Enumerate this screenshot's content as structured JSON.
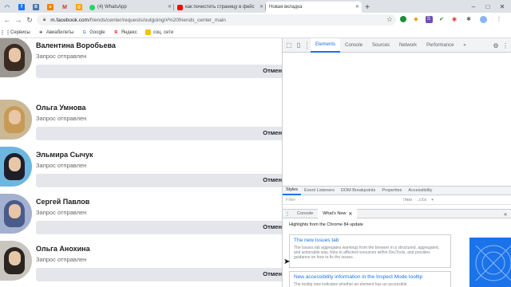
{
  "tabs": [
    {
      "label": "(4) WhatsApp",
      "favicon_color": "#25d366"
    },
    {
      "label": "как почистить страницу в фейс",
      "favicon_color": "#ff0000"
    },
    {
      "label": "Новая вкладка",
      "favicon_color": ""
    }
  ],
  "address": {
    "host": "m.facebook.com",
    "path": "/friends/center/requests/outgoing/#%20friends_center_main"
  },
  "bookmarks": [
    {
      "label": "Сервисы",
      "icon": "apps-grid-icon",
      "color": "#5f6368"
    },
    {
      "label": "Авиабилеты",
      "icon": "plane-icon",
      "color": "#333333"
    },
    {
      "label": "Google",
      "icon": "google-icon",
      "color": "#4285f4"
    },
    {
      "label": "Яндекс",
      "icon": "yandex-icon",
      "color": "#ff0000"
    },
    {
      "label": "соц. сети",
      "icon": "folder-icon",
      "color": "#f4c20d"
    }
  ],
  "friends": [
    {
      "name": "Валентина Воробьева",
      "status": "Запрос отправлен",
      "action": "Отмен",
      "avatar_hair": "#3a2a22",
      "avatar_bg": "#9a9890"
    },
    {
      "name": "Ольга Умнова",
      "status": "Запрос отправлен",
      "action": "Отмен",
      "avatar_hair": "#c89a55",
      "avatar_bg": "#cbb894"
    },
    {
      "name": "Эльмира Сычук",
      "status": "Запрос отправлен",
      "action": "Отмен",
      "avatar_hair": "#1f1f2a",
      "avatar_bg": "#6db6e0"
    },
    {
      "name": "Сергей Павлов",
      "status": "Запрос отправлен",
      "action": "Отмен",
      "avatar_hair": "#4a5b8a",
      "avatar_bg": "#a3b0d0"
    },
    {
      "name": "Ольга Анохина",
      "status": "Запрос отправлен",
      "action": "Отмен",
      "avatar_hair": "#2b2522",
      "avatar_bg": "#c9c5bf"
    }
  ],
  "devtools": {
    "tabs": [
      "Elements",
      "Console",
      "Sources",
      "Network",
      "Performance"
    ],
    "active_tab": "Elements",
    "more": "»",
    "styles_tabs": [
      "Styles",
      "Event Listeners",
      "DOM Breakpoints",
      "Properties",
      "Accessibility"
    ],
    "filter_placeholder": "Filter",
    "filter_hov": ":hov",
    "filter_cls": ".cls",
    "filter_plus": "+",
    "drawer_tabs": [
      "Console",
      "What's New"
    ],
    "highlights": "Highlights from the Chrome 84 update",
    "news": [
      {
        "title": "The new Issues tab",
        "body": "The Issues tab aggregates warnings from the browser in a structured, aggregated, and actionable way, links to affected resources within DevTools, and provides guidance on how to fix the issues."
      },
      {
        "title": "New accessibility information in the Inspect Mode tooltip",
        "body": "The tooltip now indicates whether an element has an accessible"
      }
    ]
  },
  "accent": "#1a73e8"
}
